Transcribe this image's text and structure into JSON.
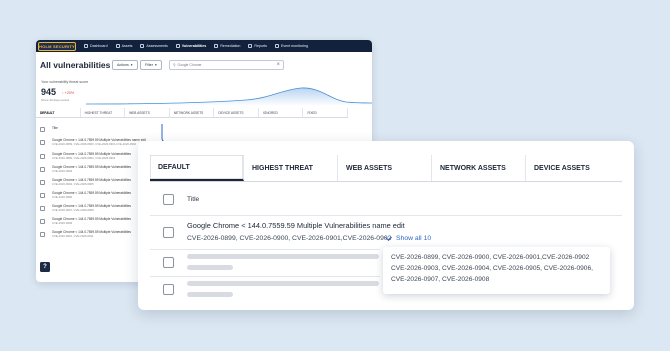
{
  "app": {
    "logo_text": "HOLM SECURITY",
    "nav": [
      "Dashboard",
      "Assets",
      "Assessments",
      "Vulnerabilities",
      "Remediation",
      "Reports",
      "Event monitoring"
    ],
    "page_title": "All vulnerabilities",
    "actions_label": "Actions",
    "filter_label": "Filter",
    "search_value": "Google Chrome",
    "score_label": "Your vulnerability threat score",
    "score_value": "945",
    "score_delta": "↑ +20%",
    "score_sub": "Since 30 days period",
    "tabs": [
      "DEFAULT",
      "HIGHEST THREAT",
      "WEB ASSETS",
      "NETWORK ASSETS",
      "DEVICE ASSETS",
      "IGNORED",
      "FIXED"
    ],
    "title_header": "Title",
    "rows": [
      {
        "title": "Google Chrome < 144.0.7559.59 Multiple Vulnerabilities name edit",
        "cves": "CVE-2026-0899, CVE-2026-0900, CVE-2026-0901,CVE-2026-0902"
      },
      {
        "title": "Google Chrome < 144.0.7559.59 Multiple Vulnerabilities",
        "cves": "CVE-2026-0899, CVE-2026-0900, CVE-2026-0901"
      },
      {
        "title": "Google Chrome < 144.0.7559.59 Multiple Vulnerabilities",
        "cves": "CVE-2026-0903"
      },
      {
        "title": "Google Chrome < 144.0.7559.59 Multiple Vulnerabilities",
        "cves": "CVE-2026-0904, CVE-2026-0905"
      },
      {
        "title": "Google Chrome < 144.0.7559.59 Multiple Vulnerabilities",
        "cves": "CVE-2026-0906"
      },
      {
        "title": "Google Chrome < 144.0.7559.59 Multiple Vulnerabilities",
        "cves": "CVE-2026-0907, CVE-2026-0908"
      },
      {
        "title": "Google Chrome < 144.0.7559.59 Multiple Vulnerabilities",
        "cves": "CVE-2026-0909"
      },
      {
        "title": "Google Chrome < 144.0.7559.59 Multiple Vulnerabilities",
        "cves": "CVE-2026-0910, CVE-2026-0911"
      }
    ],
    "help_label": "?"
  },
  "card": {
    "tabs": [
      "DEFAULT",
      "HIGHEST THREAT",
      "WEB ASSETS",
      "NETWORK ASSETS",
      "DEVICE ASSETS"
    ],
    "title_header": "Title",
    "row_title": "Google Chrome < 144.0.7559.59 Multiple Vulnerabilities name edit",
    "row_cves": "CVE-2026-0899, CVE-2026-0900, CVE-2026-0901,CVE-2026-0902",
    "show_all": "Show all 10",
    "popup_text": "CVE-2026-0899, CVE-2026-0900, CVE-2026-0901,CVE-2026-0902 CVE-2026-0903, CVE-2026-0904, CVE-2026-0905, CVE-2026-0906, CVE-2026-0907, CVE-2026-0908"
  },
  "colors": {
    "nav_bg": "#13223c",
    "brand_accent": "#f2b233",
    "link": "#2f66c5",
    "delta_red": "#d94040"
  }
}
